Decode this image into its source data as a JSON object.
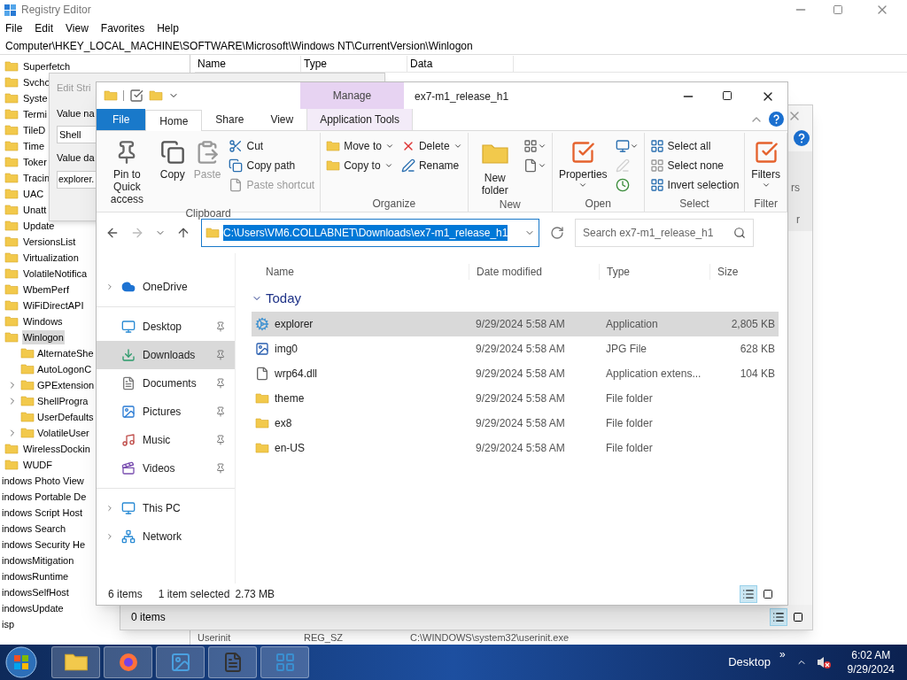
{
  "registry": {
    "title": "Registry Editor",
    "menu": [
      "File",
      "Edit",
      "View",
      "Favorites",
      "Help"
    ],
    "address": "Computer\\HKEY_LOCAL_MACHINE\\SOFTWARE\\Microsoft\\Windows NT\\CurrentVersion\\Winlogon",
    "tree": [
      {
        "label": "Superfetch",
        "selected": false
      },
      {
        "label": "Svcho",
        "selected": false
      },
      {
        "label": "Syste",
        "selected": false
      },
      {
        "label": "Termi",
        "selected": false
      },
      {
        "label": "TileD",
        "selected": false
      },
      {
        "label": "Time",
        "selected": false
      },
      {
        "label": "Toker",
        "selected": false
      },
      {
        "label": "Tracin",
        "selected": false
      },
      {
        "label": "UAC",
        "selected": false
      },
      {
        "label": "Unatt",
        "selected": false
      },
      {
        "label": "Update",
        "selected": false
      },
      {
        "label": "VersionsList",
        "selected": false
      },
      {
        "label": "Virtualization",
        "selected": false
      },
      {
        "label": "VolatileNotifica",
        "selected": false
      },
      {
        "label": "WbemPerf",
        "selected": false
      },
      {
        "label": "WiFiDirectAPI",
        "selected": false
      },
      {
        "label": "Windows",
        "selected": false
      },
      {
        "label": "Winlogon",
        "selected": true,
        "children": [
          {
            "label": "AlternateShe",
            "has_children": false
          },
          {
            "label": "AutoLogonC",
            "has_children": false
          },
          {
            "label": "GPExtension",
            "has_children": true
          },
          {
            "label": "ShellProgra",
            "has_children": true
          },
          {
            "label": "UserDefaults",
            "has_children": false
          },
          {
            "label": "VolatileUser",
            "has_children": true
          }
        ]
      },
      {
        "label": "WirelessDockin",
        "selected": false
      },
      {
        "label": "WUDF",
        "selected": false
      }
    ],
    "outer_tree": [
      "indows Photo View",
      "indows Portable De",
      "indows Script Host",
      "indows Search",
      "indows Security He",
      "indowsMitigation",
      "indowsRuntime",
      "indowsSelfHost",
      "indowsUpdate",
      "isp"
    ],
    "columns": [
      "Name",
      "Type",
      "Data"
    ],
    "rows": [
      {
        "name": "Userinit",
        "type": "REG_SZ",
        "data": "C:\\WINDOWS\\system32\\userinit.exe"
      }
    ]
  },
  "edit_dialog": {
    "title": "Edit Stri",
    "value_name_label": "Value na",
    "value_name": "Shell",
    "value_data_label": "Value da",
    "value_data": "explorer."
  },
  "back_explorer": {
    "ribbon_fragments": [
      "rs",
      "r"
    ],
    "status": "0 items",
    "views": [
      {
        "kind": "details",
        "selected": true
      },
      {
        "kind": "tiles",
        "selected": false
      }
    ]
  },
  "explorer": {
    "title": "ex7-m1_release_h1",
    "context_tab": "Manage",
    "tabs": [
      {
        "label": "File",
        "kind": "menu",
        "selected": false
      },
      {
        "label": "Home",
        "kind": "tab",
        "selected": true
      },
      {
        "label": "Share",
        "kind": "tab",
        "selected": false
      },
      {
        "label": "View",
        "kind": "tab",
        "selected": false
      },
      {
        "label": "Application Tools",
        "kind": "context",
        "selected": false
      }
    ],
    "groups": [
      {
        "label": "Clipboard",
        "buttons": [
          {
            "label": "Pin to Quick access",
            "kind": "large",
            "disabled": false,
            "menu": false
          },
          {
            "label": "Copy",
            "kind": "large",
            "disabled": false,
            "menu": false
          },
          {
            "label": "Paste",
            "kind": "large",
            "disabled": true,
            "menu": false
          },
          {
            "label": "Cut",
            "kind": "small",
            "disabled": false,
            "menu": false
          },
          {
            "label": "Copy path",
            "kind": "small",
            "disabled": false,
            "menu": false
          },
          {
            "label": "Paste shortcut",
            "kind": "small",
            "disabled": true,
            "menu": false
          }
        ]
      },
      {
        "label": "Organize",
        "buttons": [
          {
            "label": "Move to",
            "kind": "small",
            "disabled": false,
            "menu": true
          },
          {
            "label": "Copy to",
            "kind": "small",
            "disabled": false,
            "menu": true
          },
          {
            "label": "Delete",
            "kind": "small",
            "disabled": false,
            "menu": true
          },
          {
            "label": "Rename",
            "kind": "small",
            "disabled": false,
            "menu": false
          }
        ]
      },
      {
        "label": "New",
        "buttons": [
          {
            "label": "New folder",
            "kind": "large",
            "disabled": false,
            "menu": false
          },
          {
            "kind": "icon",
            "disabled": false,
            "menu": true
          },
          {
            "kind": "icon",
            "disabled": false,
            "menu": true
          }
        ]
      },
      {
        "label": "Open",
        "buttons": [
          {
            "label": "Properties",
            "kind": "large",
            "disabled": false,
            "menu": true
          },
          {
            "kind": "icon",
            "disabled": false,
            "menu": true
          },
          {
            "kind": "icon",
            "disabled": true,
            "menu": false
          },
          {
            "kind": "icon",
            "disabled": false,
            "menu": false
          }
        ]
      },
      {
        "label": "Select",
        "buttons": [
          {
            "label": "Select all",
            "kind": "small",
            "disabled": false,
            "menu": false
          },
          {
            "label": "Select none",
            "kind": "small",
            "disabled": false,
            "menu": false
          },
          {
            "label": "Invert selection",
            "kind": "small",
            "disabled": false,
            "menu": false
          }
        ]
      },
      {
        "label": "Filter",
        "buttons": [
          {
            "label": "Filters",
            "kind": "large",
            "disabled": false,
            "menu": true
          }
        ]
      }
    ],
    "path": {
      "value": "C:\\Users\\VM6.COLLABNET\\Downloads\\ex7-m1_release_h1",
      "selected": true
    },
    "search": {
      "placeholder": "Search ex7-m1_release_h1"
    },
    "nav_groups": [
      [
        {
          "label": "OneDrive",
          "kind": "cloud",
          "expandable": true,
          "pinned": false,
          "selected": false
        }
      ],
      [
        {
          "label": "Desktop",
          "kind": "desktop",
          "expandable": false,
          "pinned": true,
          "selected": false
        },
        {
          "label": "Downloads",
          "kind": "downloads",
          "expandable": false,
          "pinned": true,
          "selected": true
        },
        {
          "label": "Documents",
          "kind": "documents",
          "expandable": false,
          "pinned": true,
          "selected": false
        },
        {
          "label": "Pictures",
          "kind": "pictures",
          "expandable": false,
          "pinned": true,
          "selected": false
        },
        {
          "label": "Music",
          "kind": "music",
          "expandable": false,
          "pinned": true,
          "selected": false
        },
        {
          "label": "Videos",
          "kind": "videos",
          "expandable": false,
          "pinned": true,
          "selected": false
        }
      ],
      [
        {
          "label": "This PC",
          "kind": "pc",
          "expandable": true,
          "pinned": false,
          "selected": false
        },
        {
          "label": "Network",
          "kind": "network",
          "expandable": true,
          "pinned": false,
          "selected": false
        }
      ]
    ],
    "columns": [
      "Name",
      "Date modified",
      "Type",
      "Size"
    ],
    "group": {
      "label": "Today",
      "expanded": true
    },
    "files": [
      {
        "name": "explorer",
        "date": "9/29/2024 5:58 AM",
        "type": "Application",
        "size": "2,805 KB",
        "kind": "app",
        "selected": true
      },
      {
        "name": "img0",
        "date": "9/29/2024 5:58 AM",
        "type": "JPG File",
        "size": "628 KB",
        "kind": "image",
        "selected": false
      },
      {
        "name": "wrp64.dll",
        "date": "9/29/2024 5:58 AM",
        "type": "Application extens...",
        "size": "104 KB",
        "kind": "dll",
        "selected": false
      },
      {
        "name": "theme",
        "date": "9/29/2024 5:58 AM",
        "type": "File folder",
        "kind": "folder",
        "selected": false
      },
      {
        "name": "ex8",
        "date": "9/29/2024 5:58 AM",
        "type": "File folder",
        "kind": "folder",
        "selected": false
      },
      {
        "name": "en-US",
        "date": "9/29/2024 5:58 AM",
        "type": "File folder",
        "kind": "folder",
        "selected": false
      }
    ],
    "status": {
      "count": "6 items",
      "selection": "1 item selected",
      "size": "2.73 MB"
    },
    "views": [
      {
        "kind": "details",
        "selected": true
      },
      {
        "kind": "tiles",
        "selected": false
      }
    ]
  },
  "taskbar": {
    "apps": [
      {
        "kind": "folder"
      },
      {
        "kind": "firefox"
      },
      {
        "kind": "image"
      },
      {
        "kind": "document"
      },
      {
        "kind": "cube"
      }
    ],
    "show_desktop": "Desktop",
    "overflow": "»",
    "time": "6:02 AM",
    "date": "9/29/2024"
  }
}
